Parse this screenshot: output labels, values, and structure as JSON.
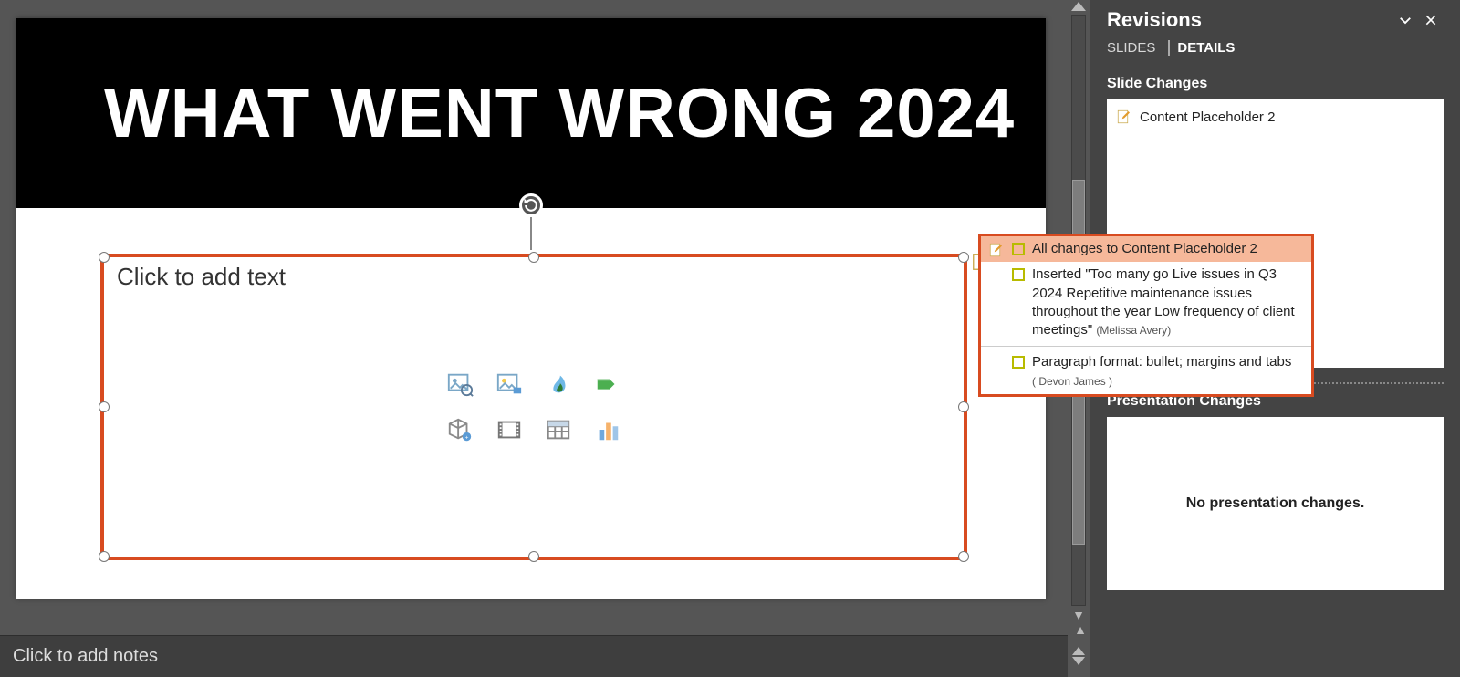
{
  "slide": {
    "title": "WHAT WENT WRONG 2024",
    "content_placeholder": "Click to add text"
  },
  "notes_placeholder": "Click to add notes",
  "revisions": {
    "title": "Revisions",
    "tabs": {
      "slides": "SLIDES",
      "details": "DETAILS"
    },
    "slide_changes_label": "Slide Changes",
    "slide_changes_item": "Content Placeholder 2",
    "presentation_changes_label": "Presentation Changes",
    "no_presentation_changes": "No presentation changes."
  },
  "popup": {
    "header": "All changes to Content Placeholder 2",
    "insert_text_prefix": "Inserted \"",
    "insert_text_body": "Too many go Live issues in Q3 2024 Repetitive maintenance issues throughout the year Low frequency of client meetings",
    "insert_text_suffix": "\"",
    "insert_author": "Melissa Avery",
    "format_text": "Paragraph format: bullet; margins and tabs",
    "format_author": "Devon James"
  },
  "icons": {
    "rotate": "rotate-icon",
    "close": "close-icon",
    "chevron": "chevron-down-icon",
    "revision": "revision-edit-icon"
  }
}
